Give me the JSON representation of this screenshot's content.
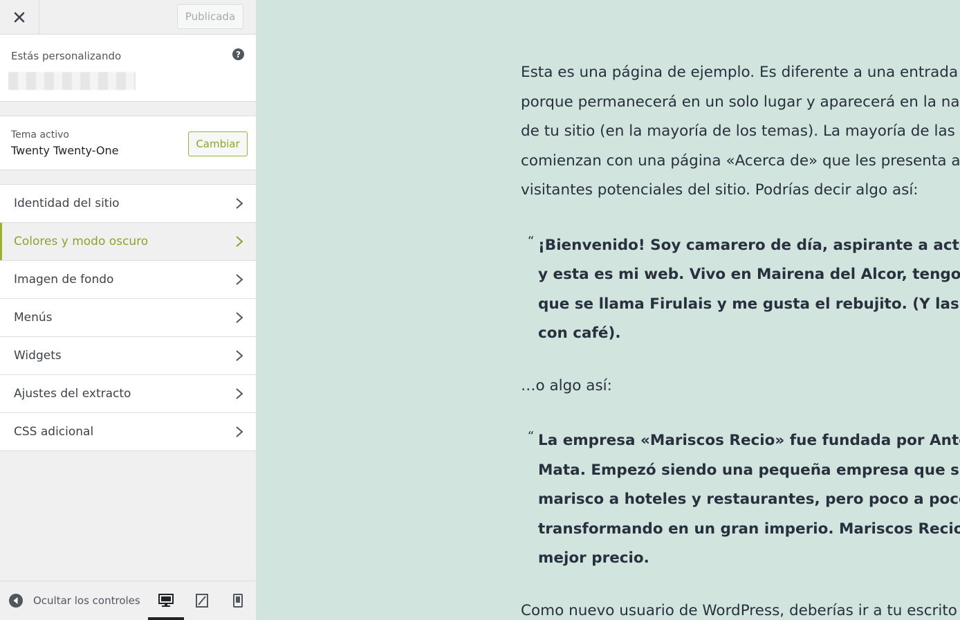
{
  "topbar": {
    "close_label": "×",
    "publish_label": "Publicada"
  },
  "info": {
    "label": "Estás personalizando",
    "help": "?"
  },
  "theme": {
    "label": "Tema activo",
    "name": "Twenty Twenty-One",
    "change_label": "Cambiar"
  },
  "menu": {
    "items": [
      {
        "label": "Identidad del sitio"
      },
      {
        "label": "Colores y modo oscuro",
        "active": true
      },
      {
        "label": "Imagen de fondo"
      },
      {
        "label": "Menús"
      },
      {
        "label": "Widgets"
      },
      {
        "label": "Ajustes del extracto"
      },
      {
        "label": "CSS adicional"
      }
    ]
  },
  "footer": {
    "hide_label": "Ocultar los controles"
  },
  "colors": {
    "accent": "#9ab32b",
    "preview_bg": "#d1e4dd",
    "text": "#28303d"
  },
  "preview": {
    "para1": [
      "Esta es una página de ejemplo. Es diferente a una entrada",
      "porque permanecerá en un solo lugar y aparecerá en la na",
      "de tu sitio (en la mayoría de los temas). La mayoría de las",
      "comienzan con una página «Acerca de» que les presenta a",
      "visitantes potenciales del sitio. Podrías decir algo así:"
    ],
    "quote1": [
      "¡Bienvenido! Soy camarero de día, aspirante a actor",
      "y esta es mi web. Vivo en Mairena del Alcor, tengo u",
      "que se llama Firulais y me gusta el rebujito. (Y las tar",
      "con café)."
    ],
    "para2": "…o algo así:",
    "quote2": [
      "La empresa «Mariscos Recio» fue fundada por Anton",
      "Mata. Empezó siendo una pequeña empresa que sur",
      "marisco a hoteles y restaurantes, pero poco a poco s",
      "transformando en un gran imperio. Mariscos Recio,",
      "mejor precio."
    ],
    "para3": "Como nuevo usuario de WordPress, deberías ir a tu escrito",
    "quote_mark": "“"
  }
}
